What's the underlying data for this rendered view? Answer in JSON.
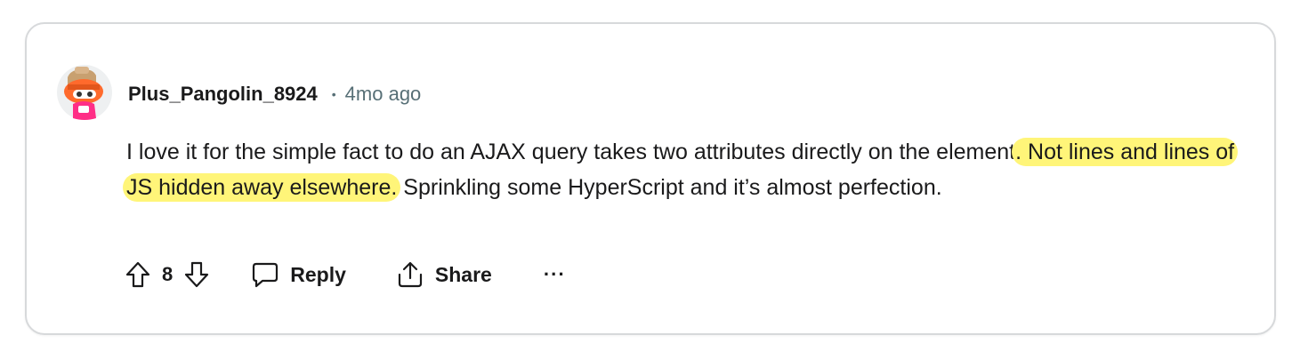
{
  "comment": {
    "author": "Plus_Pangolin_8924",
    "separator": "•",
    "time": "4mo ago",
    "body": {
      "part1": "I love it for the simple fact to do an AJAX query takes two attributes directly on the element",
      "highlight": ". Not lines and lines of JS hidden away elsewhere.",
      "part2": " Sprinkling some HyperScript and it’s almost perfection."
    },
    "highlight_color": "#fff579"
  },
  "actions": {
    "upvote_icon": "arrow-up-icon",
    "vote_count": "8",
    "downvote_icon": "arrow-down-icon",
    "reply_label": "Reply",
    "reply_icon": "speech-bubble-icon",
    "share_label": "Share",
    "share_icon": "share-icon",
    "more_label": "···",
    "more_icon": "ellipsis-icon"
  },
  "colors": {
    "text": "#1a1a1b",
    "muted": "#576f76",
    "border": "#d7d9db"
  }
}
